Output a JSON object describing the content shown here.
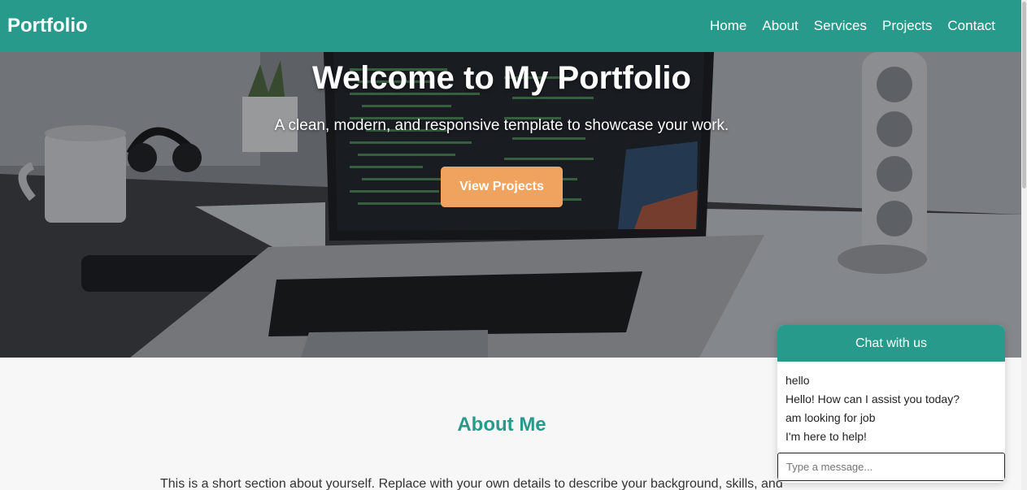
{
  "nav": {
    "brand": "Portfolio",
    "links": [
      "Home",
      "About",
      "Services",
      "Projects",
      "Contact"
    ]
  },
  "hero": {
    "title": "Welcome to My Portfolio",
    "subtitle": "A clean, modern, and responsive template to showcase your work.",
    "cta": "View Projects"
  },
  "about": {
    "title": "About Me",
    "text": "This is a short section about yourself. Replace with your own details to describe your background, skills, and"
  },
  "chat": {
    "title": "Chat with us",
    "messages": [
      "hello",
      "Hello! How can I assist you today?",
      "am looking for job",
      "I'm here to help!"
    ],
    "input_placeholder": "Type a message..."
  },
  "colors": {
    "primary": "#289a8b",
    "accent": "#f0a35e"
  }
}
